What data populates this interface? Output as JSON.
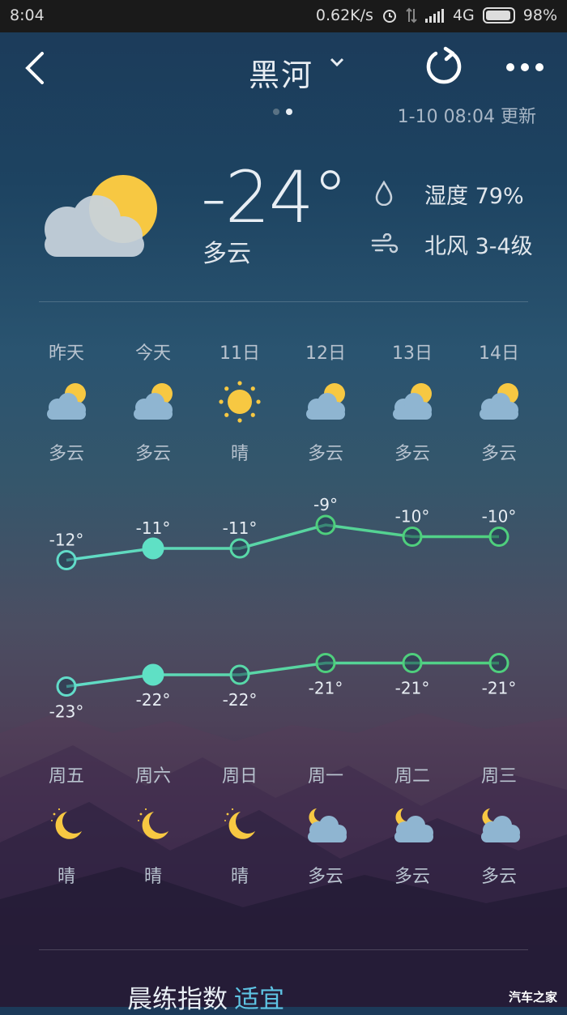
{
  "status_bar": {
    "time": "8:04",
    "network_speed": "0.62K/s",
    "network_type": "4G",
    "battery": "98%"
  },
  "header": {
    "city": "黑河",
    "updated": "1-10 08:04 更新",
    "page_count": 2,
    "current_page": 2
  },
  "current": {
    "temperature": "-24°",
    "condition": "多云",
    "icon": "partly-cloudy-day-icon",
    "humidity": "湿度 79%",
    "wind": "北风 3-4级"
  },
  "day_forecast": [
    {
      "label": "昨天",
      "condition": "多云",
      "icon": "partly-cloudy-day-icon",
      "high": "-12°",
      "low": "-23°",
      "high_value": -12,
      "low_value": -23
    },
    {
      "label": "今天",
      "condition": "多云",
      "icon": "partly-cloudy-day-icon",
      "high": "-11°",
      "low": "-22°",
      "high_value": -11,
      "low_value": -22
    },
    {
      "label": "11日",
      "condition": "晴",
      "icon": "sun-icon",
      "high": "-11°",
      "low": "-22°",
      "high_value": -11,
      "low_value": -22
    },
    {
      "label": "12日",
      "condition": "多云",
      "icon": "partly-cloudy-day-icon",
      "high": "-9°",
      "low": "-21°",
      "high_value": -9,
      "low_value": -21
    },
    {
      "label": "13日",
      "condition": "多云",
      "icon": "partly-cloudy-day-icon",
      "high": "-10°",
      "low": "-21°",
      "high_value": -10,
      "low_value": -21
    },
    {
      "label": "14日",
      "condition": "多云",
      "icon": "partly-cloudy-day-icon",
      "high": "-10°",
      "low": "-21°",
      "high_value": -10,
      "low_value": -21
    }
  ],
  "night_forecast": [
    {
      "label": "周五",
      "condition": "晴",
      "icon": "moon-icon"
    },
    {
      "label": "周六",
      "condition": "晴",
      "icon": "moon-icon"
    },
    {
      "label": "周日",
      "condition": "晴",
      "icon": "moon-icon"
    },
    {
      "label": "周一",
      "condition": "多云",
      "icon": "partly-cloudy-night-icon"
    },
    {
      "label": "周二",
      "condition": "多云",
      "icon": "partly-cloudy-night-icon"
    },
    {
      "label": "周三",
      "condition": "多云",
      "icon": "partly-cloudy-night-icon"
    }
  ],
  "index": {
    "name": "晨练指数",
    "value": "适宜"
  },
  "watermark": "汽车之家",
  "colors": {
    "line_start": "#62dcc9",
    "line_end": "#4fcf7d",
    "today_fill": "#5fe0c5",
    "accent": "#5ec3e3"
  }
}
